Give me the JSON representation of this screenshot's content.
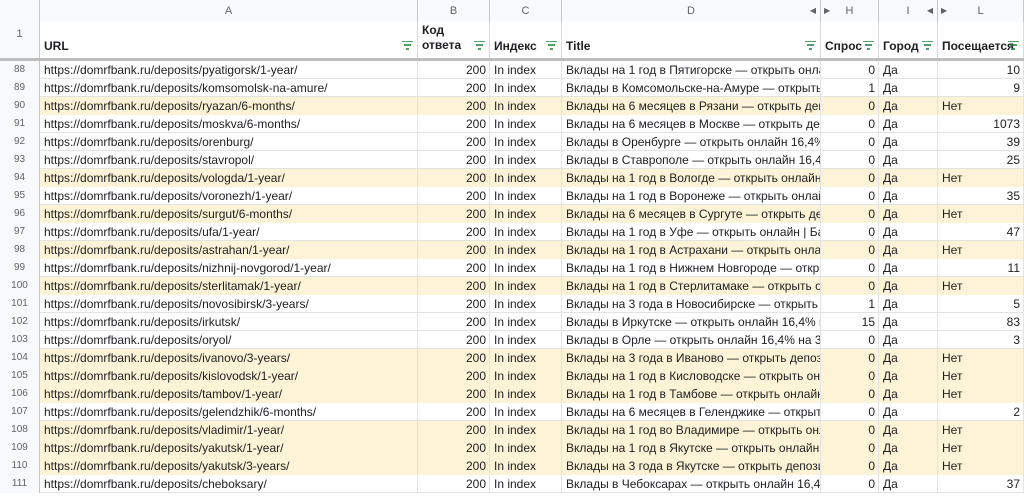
{
  "column_letters": [
    "A",
    "B",
    "C",
    "D",
    "H",
    "I",
    "L"
  ],
  "headers": {
    "row_number": "1",
    "url": "URL",
    "code": "Код ответа",
    "index": "Индекс",
    "title": "Title",
    "demand": "Спрос",
    "city": "Город",
    "visits": "Посещается"
  },
  "colors": {
    "highlight": "#fdf3d6",
    "filter_icon": "#188038"
  },
  "rows": [
    {
      "n": "88",
      "url": "https://domrfbank.ru/deposits/pyatigorsk/1-year/",
      "code": "200",
      "index": "In index",
      "title": "Вклады на 1 год в Пятигорске — открыть онлайн",
      "demand": "0",
      "city": "Да",
      "visits": "10",
      "hl": false
    },
    {
      "n": "89",
      "url": "https://domrfbank.ru/deposits/komsomolsk-na-amure/",
      "code": "200",
      "index": "In index",
      "title": "Вклады в Комсомольске-на-Амуре — открыть о",
      "demand": "1",
      "city": "Да",
      "visits": "9",
      "hl": false
    },
    {
      "n": "90",
      "url": "https://domrfbank.ru/deposits/ryazan/6-months/",
      "code": "200",
      "index": "In index",
      "title": "Вклады на 6 месяцев в Рязани — открыть депози",
      "demand": "0",
      "city": "Да",
      "visits": "Нет",
      "hl": true
    },
    {
      "n": "91",
      "url": "https://domrfbank.ru/deposits/moskva/6-months/",
      "code": "200",
      "index": "In index",
      "title": "Вклады на 6 месяцев в Москве — открыть депо",
      "demand": "0",
      "city": "Да",
      "visits": "1073",
      "hl": false
    },
    {
      "n": "92",
      "url": "https://domrfbank.ru/deposits/orenburg/",
      "code": "200",
      "index": "In index",
      "title": "Вклады в Оренбурге — открыть онлайн 16,4% н",
      "demand": "0",
      "city": "Да",
      "visits": "39",
      "hl": false
    },
    {
      "n": "93",
      "url": "https://domrfbank.ru/deposits/stavropol/",
      "code": "200",
      "index": "In index",
      "title": "Вклады в Ставрополе — открыть онлайн 16,4%",
      "demand": "0",
      "city": "Да",
      "visits": "25",
      "hl": false
    },
    {
      "n": "94",
      "url": "https://domrfbank.ru/deposits/vologda/1-year/",
      "code": "200",
      "index": "In index",
      "title": "Вклады на 1 год в Вологде — открыть онлайн |",
      "demand": "0",
      "city": "Да",
      "visits": "Нет",
      "hl": true
    },
    {
      "n": "95",
      "url": "https://domrfbank.ru/deposits/voronezh/1-year/",
      "code": "200",
      "index": "In index",
      "title": "Вклады на 1 год в Воронеже — открыть онлайн",
      "demand": "0",
      "city": "Да",
      "visits": "35",
      "hl": false
    },
    {
      "n": "96",
      "url": "https://domrfbank.ru/deposits/surgut/6-months/",
      "code": "200",
      "index": "In index",
      "title": "Вклады на 6 месяцев в Сургуте — открыть депо",
      "demand": "0",
      "city": "Да",
      "visits": "Нет",
      "hl": true
    },
    {
      "n": "97",
      "url": "https://domrfbank.ru/deposits/ufa/1-year/",
      "code": "200",
      "index": "In index",
      "title": "Вклады на 1 год в Уфе — открыть онлайн | Банк",
      "demand": "0",
      "city": "Да",
      "visits": "47",
      "hl": false
    },
    {
      "n": "98",
      "url": "https://domrfbank.ru/deposits/astrahan/1-year/",
      "code": "200",
      "index": "In index",
      "title": "Вклады на 1 год в Астрахани — открыть онлайн",
      "demand": "0",
      "city": "Да",
      "visits": "Нет",
      "hl": true
    },
    {
      "n": "99",
      "url": "https://domrfbank.ru/deposits/nizhnij-novgorod/1-year/",
      "code": "200",
      "index": "In index",
      "title": "Вклады на 1 год в Нижнем Новгороде — открыт",
      "demand": "0",
      "city": "Да",
      "visits": "11",
      "hl": false
    },
    {
      "n": "100",
      "url": "https://domrfbank.ru/deposits/sterlitamak/1-year/",
      "code": "200",
      "index": "In index",
      "title": "Вклады на 1 год в Стерлитамаке — открыть онл",
      "demand": "0",
      "city": "Да",
      "visits": "Нет",
      "hl": true
    },
    {
      "n": "101",
      "url": "https://domrfbank.ru/deposits/novosibirsk/3-years/",
      "code": "200",
      "index": "In index",
      "title": "Вклады на 3 года в Новосибирске — открыть де",
      "demand": "1",
      "city": "Да",
      "visits": "5",
      "hl": false
    },
    {
      "n": "102",
      "url": "https://domrfbank.ru/deposits/irkutsk/",
      "code": "200",
      "index": "In index",
      "title": "Вклады в Иркутске — открыть онлайн 16,4% на",
      "demand": "15",
      "city": "Да",
      "visits": "83",
      "hl": false
    },
    {
      "n": "103",
      "url": "https://domrfbank.ru/deposits/oryol/",
      "code": "200",
      "index": "In index",
      "title": "Вклады в Орле — открыть онлайн 16,4% на 3 м",
      "demand": "0",
      "city": "Да",
      "visits": "3",
      "hl": false
    },
    {
      "n": "104",
      "url": "https://domrfbank.ru/deposits/ivanovo/3-years/",
      "code": "200",
      "index": "In index",
      "title": "Вклады на 3 года в Иваново — открыть депозит",
      "demand": "0",
      "city": "Да",
      "visits": "Нет",
      "hl": true
    },
    {
      "n": "105",
      "url": "https://domrfbank.ru/deposits/kislovodsk/1-year/",
      "code": "200",
      "index": "In index",
      "title": "Вклады на 1 год в Кисловодске — открыть онла",
      "demand": "0",
      "city": "Да",
      "visits": "Нет",
      "hl": true
    },
    {
      "n": "106",
      "url": "https://domrfbank.ru/deposits/tambov/1-year/",
      "code": "200",
      "index": "In index",
      "title": "Вклады на 1 год в Тамбове — открыть онлайн |",
      "demand": "0",
      "city": "Да",
      "visits": "Нет",
      "hl": true
    },
    {
      "n": "107",
      "url": "https://domrfbank.ru/deposits/gelendzhik/6-months/",
      "code": "200",
      "index": "In index",
      "title": "Вклады на 6 месяцев в Геленджике — открыть д",
      "demand": "0",
      "city": "Да",
      "visits": "2",
      "hl": false
    },
    {
      "n": "108",
      "url": "https://domrfbank.ru/deposits/vladimir/1-year/",
      "code": "200",
      "index": "In index",
      "title": "Вклады на 1 год во Владимире — открыть онлай",
      "demand": "0",
      "city": "Да",
      "visits": "Нет",
      "hl": true
    },
    {
      "n": "109",
      "url": "https://domrfbank.ru/deposits/yakutsk/1-year/",
      "code": "200",
      "index": "In index",
      "title": "Вклады на 1 год в Якутске — открыть онлайн | Б",
      "demand": "0",
      "city": "Да",
      "visits": "Нет",
      "hl": true
    },
    {
      "n": "110",
      "url": "https://domrfbank.ru/deposits/yakutsk/3-years/",
      "code": "200",
      "index": "In index",
      "title": "Вклады на 3 года в Якутске — открыть депозит",
      "demand": "0",
      "city": "Да",
      "visits": "Нет",
      "hl": true
    },
    {
      "n": "111",
      "url": "https://domrfbank.ru/deposits/cheboksary/",
      "code": "200",
      "index": "In index",
      "title": "Вклады в Чебоксарах — открыть онлайн 16,4%",
      "demand": "0",
      "city": "Да",
      "visits": "37",
      "hl": false
    }
  ]
}
